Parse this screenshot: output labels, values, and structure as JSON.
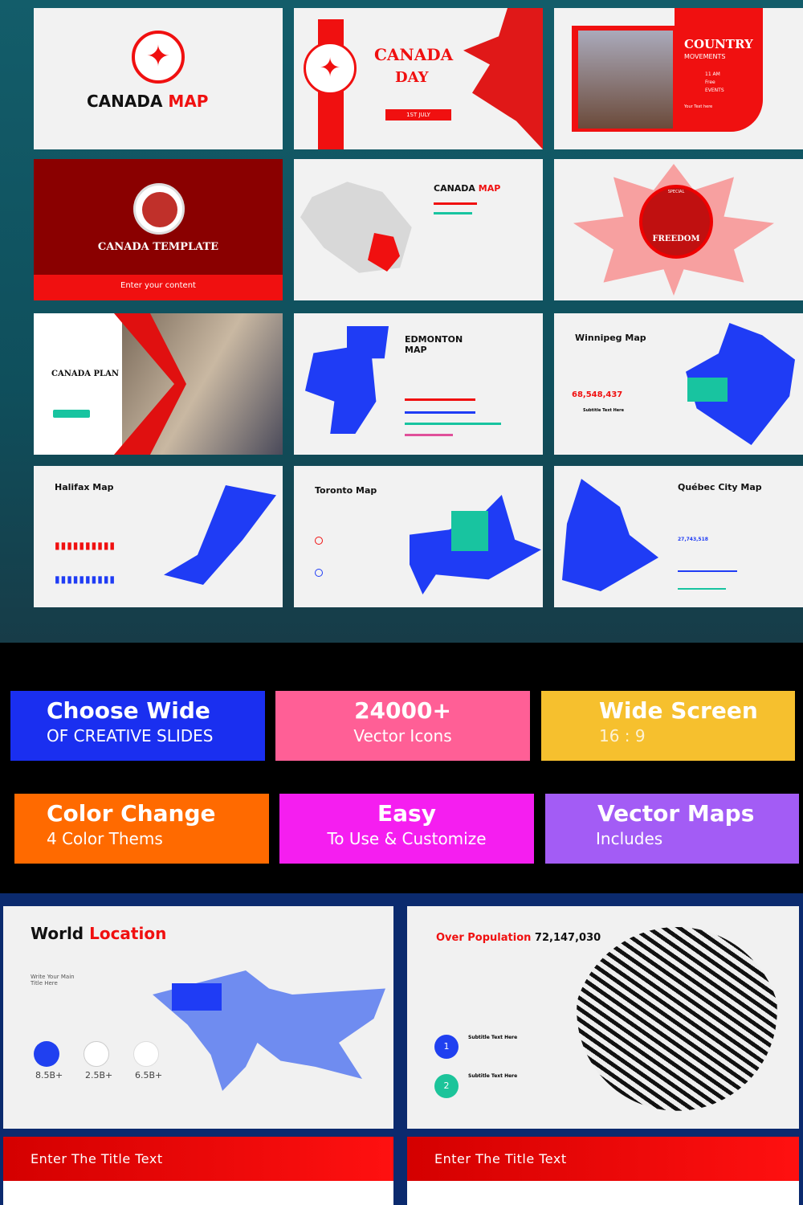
{
  "slides": [
    {
      "title": "CANADA",
      "title_accent": "MAP"
    },
    {
      "title": "CANADA",
      "subtitle": "DAY",
      "badge": "1ST JULY"
    },
    {
      "title": "COUNTRY",
      "subtitle": "MOVEMENTS",
      "rows": [
        "11 AM",
        "Free",
        "EVENTS"
      ],
      "text": "Your Text here"
    },
    {
      "title": "CANADA TEMPLATE",
      "button": "Enter your content"
    },
    {
      "title": "CANADA",
      "title_accent": "MAP"
    },
    {
      "title": "FREEDOM",
      "kicker": "SPECIAL"
    },
    {
      "title": "CANADA PLAN"
    },
    {
      "title": "EDMONTON MAP"
    },
    {
      "title": "Winnipeg Map",
      "value": "68,548,437",
      "sub": "Subtitle Text Here"
    },
    {
      "title": "Halifax Map"
    },
    {
      "title": "Toronto Map"
    },
    {
      "title": "Québec City Map",
      "value": "27,743,518"
    }
  ],
  "features": [
    {
      "title": "Choose Wide",
      "sub": "OF CREATIVE SLIDES",
      "color": "#1a2ff0"
    },
    {
      "title": "24000+",
      "sub": "Vector Icons",
      "color": "#ff5f96"
    },
    {
      "title": "Wide Screen",
      "sub": "16 : 9",
      "color": "#f6c02e"
    },
    {
      "title": "Color Change",
      "sub": "4 Color Thems",
      "color": "#ff6a00"
    },
    {
      "title": "Easy",
      "sub": "To Use & Customize",
      "color": "#f51ef0"
    },
    {
      "title": "Vector Maps",
      "sub": "Includes",
      "color": "#a35cf5"
    }
  ],
  "world": {
    "title": "World",
    "title_accent": "Location",
    "subhead": "Write Your Main Title Here",
    "stats": [
      "8.5B+",
      "2.5B+",
      "6.5B+"
    ]
  },
  "population": {
    "title_accent": "Over Population",
    "value": "72,147,030",
    "items": [
      {
        "num": "1",
        "label": "Subtitle Text Here"
      },
      {
        "num": "2",
        "label": "Subtitle Text Here"
      }
    ]
  },
  "banners": [
    "Enter The Title Text",
    "Enter The Title Text"
  ]
}
